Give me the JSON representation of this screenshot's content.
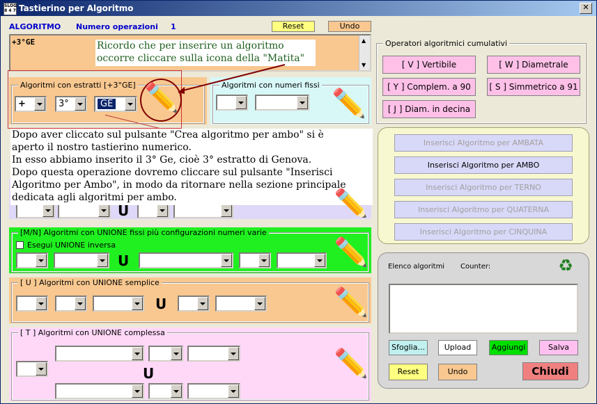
{
  "window": {
    "title": "Tastierino per Algoritmo",
    "icon_text": "SLOG 8 4 7"
  },
  "header": {
    "algo_label": "ALGORITMO",
    "numops_label": "Numero operazioni",
    "numops_value": "1",
    "reset_label": "Reset",
    "undo_label": "Undo",
    "algo_text": "+3°GE"
  },
  "note_top": {
    "line1": "Ricordo che per inserire un algoritmo",
    "line2": "occorre cliccare sulla icona della \"Matita\""
  },
  "estratti": {
    "legend": "Algoritmi con estratti  [+3°GE]",
    "op": "+",
    "pos": "3°",
    "ruota": "GE"
  },
  "fissi": {
    "legend": "Algoritmi con numeri fissi"
  },
  "note_main": {
    "lines": [
      "Dopo aver cliccato sul pulsante \"Crea algoritmo per ambo\" si è",
      "aperto il nostro tastierino numerico.",
      "In esso abbiamo inserito il 3° Ge, cioè 3° estratto di Genova.",
      "Dopo questa operazione dovremo cliccare sul pulsante \"Inserisci",
      "Algoritmo per Ambo\", in modo da ritornare nella sezione principale",
      "dedicata agli algoritmi per ambo."
    ]
  },
  "u_label": "U",
  "mn": {
    "legend": "[M/N] Algoritmi con UNIONE fissi più configurazioni numeri varie",
    "check_label": "Esegui UNIONE inversa"
  },
  "union_simple": {
    "legend": "[ U ] Algoritmi con UNIONE semplice"
  },
  "union_complex": {
    "legend": "[ T ] Algoritmi con UNIONE complessa"
  },
  "cumulativi": {
    "legend": "Operatori algoritmici cumulativi",
    "buttons": [
      "[ V ] Vertibile",
      "[ W ] Diametrale",
      "[ Y ] Complem. a 90",
      "[ S ] Simmetrico  a 91",
      "[ J ] Diam. in decina"
    ]
  },
  "inserisci": {
    "ambata": "Inserisci Algoritmo per AMBATA",
    "ambo": "Inserisci Algoritmo per AMBO",
    "terno": "Inserisci Algoritmo per TERNO",
    "quaterna": "Inserisci Algoritmo per QUATERNA",
    "cinquina": "Inserisci Algoritmo per CINQUINA"
  },
  "elenco": {
    "label": "Elenco algoritmi",
    "counter_label": "Counter:",
    "sfoglia": "Sfoglia...",
    "upload": "Upload",
    "aggiungi": "Aggiungi",
    "salva": "Salva",
    "reset": "Reset",
    "undo": "Undo",
    "chiudi": "Chiudi"
  },
  "colors": {
    "orange": "#f8c890",
    "cyan": "#d8f8f8",
    "green": "#20f020",
    "lavender": "#e0d8f8",
    "pink": "#ffd8f8",
    "yellow_panel": "#f8f8d0"
  }
}
